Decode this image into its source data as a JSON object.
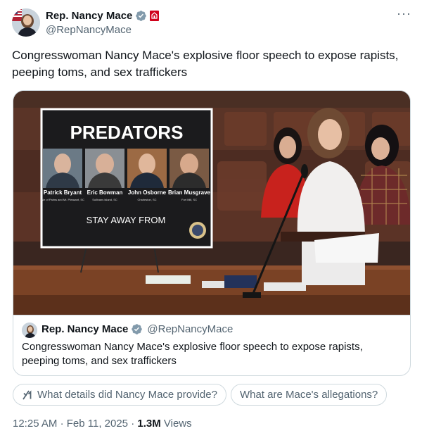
{
  "post": {
    "author": {
      "display_name": "Rep. Nancy Mace",
      "handle": "@RepNancyMace",
      "verified_color": "#829aab",
      "badge_color": "#d0021b"
    },
    "more_label": "···",
    "text": "Congresswoman Nancy Mace's explosive floor speech to expose rapists, peeping toms, and sex traffickers"
  },
  "media": {
    "poster": {
      "title": "PREDATORS",
      "people": [
        {
          "name": "Patrick Bryant",
          "location": "Isle of Palms and Mt. Pleasant, SC"
        },
        {
          "name": "Eric Bowman",
          "location": "Sullivans Island, SC"
        },
        {
          "name": "John Osborne",
          "location": "Charleston, SC"
        },
        {
          "name": "Brian Musgrave",
          "location": "Fort Mill, SC"
        }
      ],
      "footer": "STAY AWAY FROM"
    }
  },
  "quote": {
    "display_name": "Rep. Nancy Mace",
    "handle": "@RepNancyMace",
    "text": "Congresswoman Nancy Mace's explosive floor speech to expose rapists, peeping toms, and sex traffickers"
  },
  "grok_prompts": [
    {
      "label": "What details did Nancy Mace provide?",
      "icon": "grok-icon"
    },
    {
      "label": "What are Mace's allegations?",
      "icon": ""
    }
  ],
  "meta": {
    "time": "12:25 AM",
    "separator": "·",
    "date": "Feb 11, 2025",
    "views_count": "1.3M",
    "views_label": "Views"
  }
}
